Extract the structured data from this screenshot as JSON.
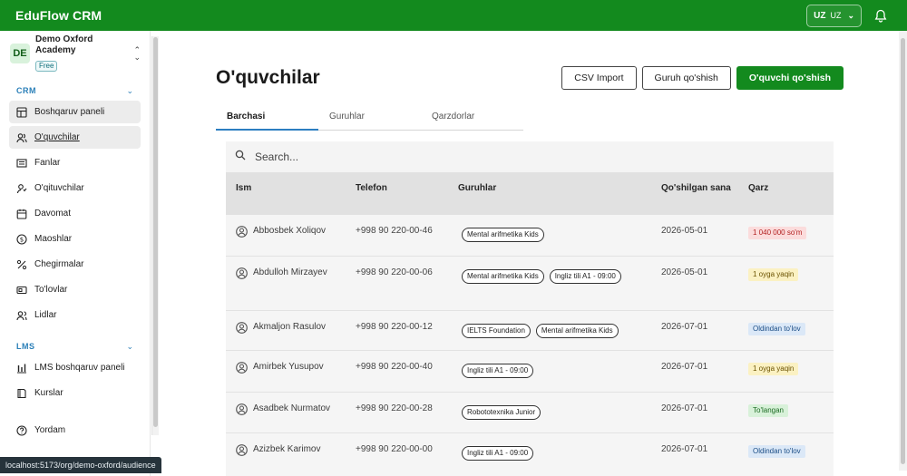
{
  "brand": "EduFlow CRM",
  "lang": {
    "code": "UZ",
    "label": "UZ"
  },
  "org": {
    "initials": "DE",
    "name": "Demo Oxford Academy",
    "plan": "Free"
  },
  "sidebar": {
    "crm_label": "CRM",
    "crm_items": [
      {
        "label": "Boshqaruv paneli",
        "icon": "dashboard-icon"
      },
      {
        "label": "O'quvchilar",
        "icon": "users-icon"
      },
      {
        "label": "Fanlar",
        "icon": "book-icon"
      },
      {
        "label": "O'qituvchilar",
        "icon": "teacher-icon"
      },
      {
        "label": "Davomat",
        "icon": "calendar-icon"
      },
      {
        "label": "Maoshlar",
        "icon": "dollar-icon"
      },
      {
        "label": "Chegirmalar",
        "icon": "percent-icon"
      },
      {
        "label": "To'lovlar",
        "icon": "payments-icon"
      },
      {
        "label": "Lidlar",
        "icon": "leads-icon"
      }
    ],
    "lms_label": "LMS",
    "lms_items": [
      {
        "label": "LMS boshqaruv paneli",
        "icon": "chart-icon"
      },
      {
        "label": "Kurslar",
        "icon": "course-icon"
      }
    ],
    "help_label": "Yordam"
  },
  "main": {
    "title": "O'quvchilar",
    "buttons": {
      "csv": "CSV Import",
      "group": "Guruh qo'shish",
      "add": "O'quvchi qo'shish"
    },
    "tabs": [
      "Barchasi",
      "Guruhlar",
      "Qarzdorlar"
    ],
    "search_placeholder": "Search...",
    "columns": {
      "name": "Ism",
      "phone": "Telefon",
      "groups": "Guruhlar",
      "date": "Qo'shilgan sana",
      "debt": "Qarz"
    },
    "rows": [
      {
        "name": "Abbosbek Xoliqov",
        "phone": "+998 90 220-00-46",
        "groups": [
          "Mental arifmetika Kids"
        ],
        "date": "2026-05-01",
        "debt": "1 040 000 so'm",
        "debt_kind": "red"
      },
      {
        "name": "Abdulloh Mirzayev",
        "phone": "+998 90 220-00-06",
        "groups": [
          "Mental arifmetika Kids",
          "Ingliz tili A1 - 09:00"
        ],
        "date": "2026-05-01",
        "debt": "1 oyga yaqin",
        "debt_kind": "yellow"
      },
      {
        "name": "Akmaljon Rasulov",
        "phone": "+998 90 220-00-12",
        "groups": [
          "IELTS Foundation",
          "Mental arifmetika Kids"
        ],
        "date": "2026-07-01",
        "debt": "Oldindan to'lov",
        "debt_kind": "blue"
      },
      {
        "name": "Amirbek Yusupov",
        "phone": "+998 90 220-00-40",
        "groups": [
          "Ingliz tili A1 - 09:00"
        ],
        "date": "2026-07-01",
        "debt": "1 oyga yaqin",
        "debt_kind": "yellow"
      },
      {
        "name": "Asadbek Nurmatov",
        "phone": "+998 90 220-00-28",
        "groups": [
          "Robototexnika Junior"
        ],
        "date": "2026-07-01",
        "debt": "To'langan",
        "debt_kind": "green"
      },
      {
        "name": "Azizbek Karimov",
        "phone": "+998 90 220-00-00",
        "groups": [
          "Ingliz tili A1 - 09:00"
        ],
        "date": "2026-07-01",
        "debt": "Oldindan to'lov",
        "debt_kind": "blue"
      }
    ]
  },
  "statusbar": "localhost:5173/org/demo-oxford/audience"
}
